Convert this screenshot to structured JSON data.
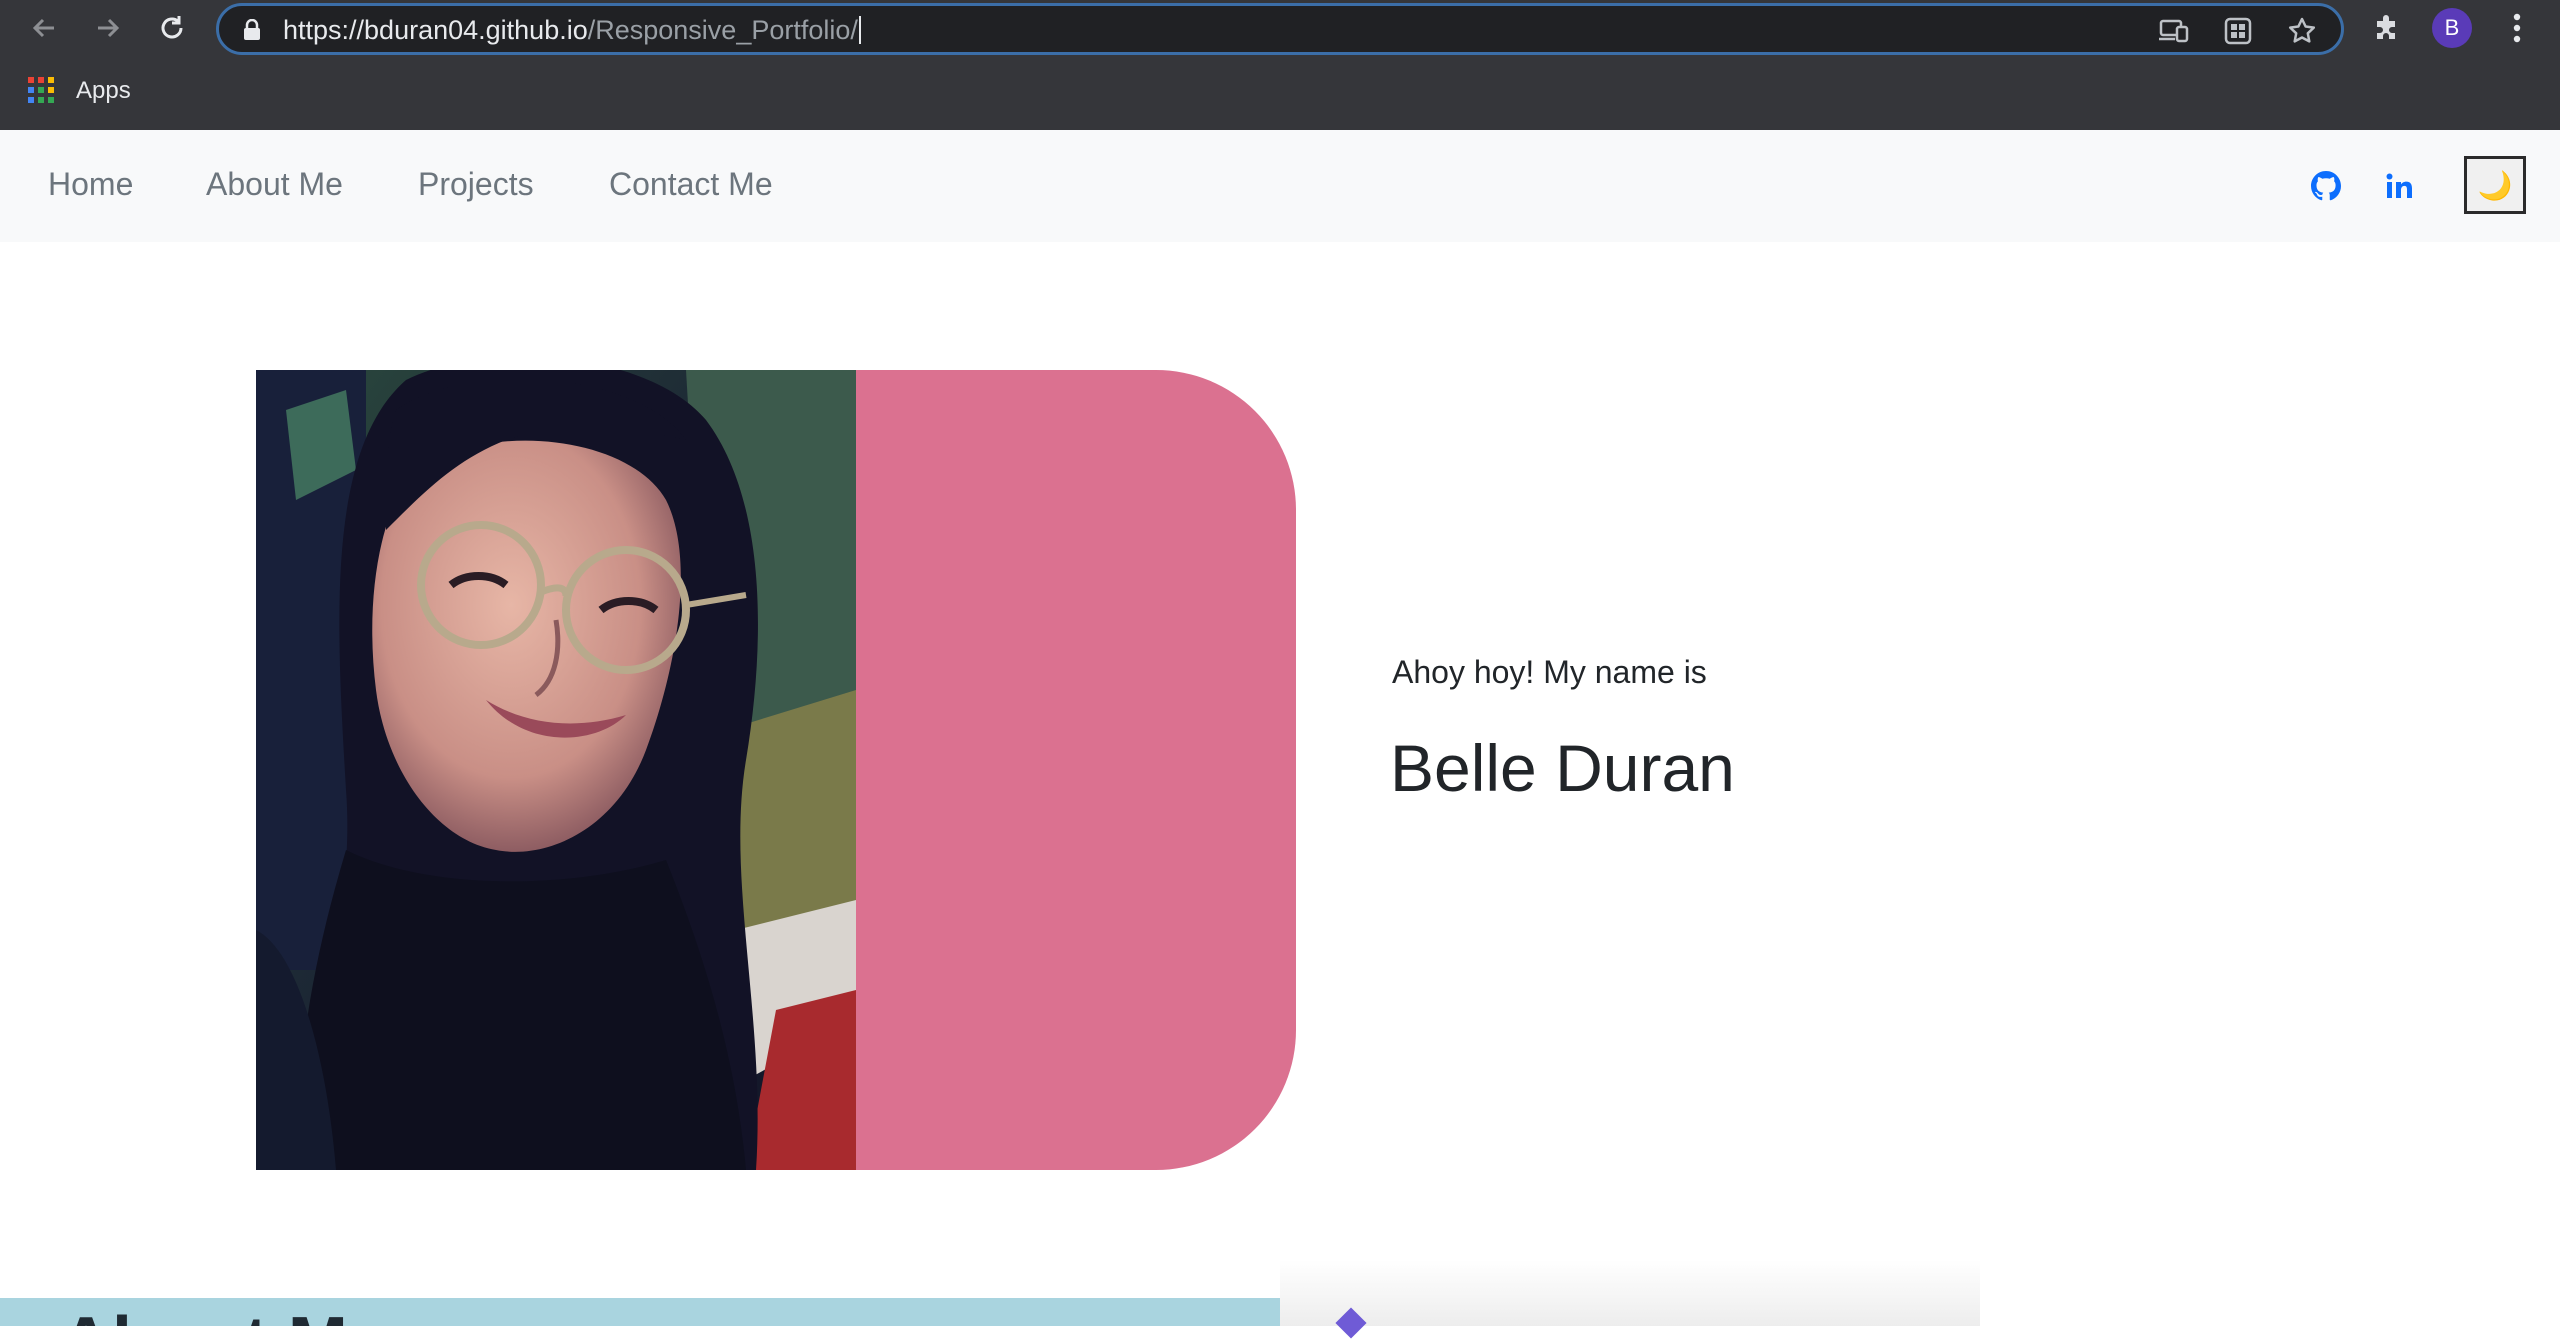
{
  "browser": {
    "url_host": "https://bduran04.github.io",
    "url_path": "/Responsive_Portfolio/",
    "profile_initial": "B",
    "bookmarks": [
      {
        "label": "Apps"
      }
    ]
  },
  "site": {
    "nav": {
      "links": [
        {
          "label": "Home"
        },
        {
          "label": "About Me"
        },
        {
          "label": "Projects"
        },
        {
          "label": "Contact Me"
        }
      ],
      "social": [
        "github-icon",
        "linkedin-icon"
      ],
      "theme_toggle_icon": "🌙"
    },
    "hero": {
      "intro": "Ahoy hoy! My name is",
      "name": "Belle Duran",
      "accent_color": "#db7190"
    },
    "next_section": {
      "title": "About Me"
    }
  }
}
